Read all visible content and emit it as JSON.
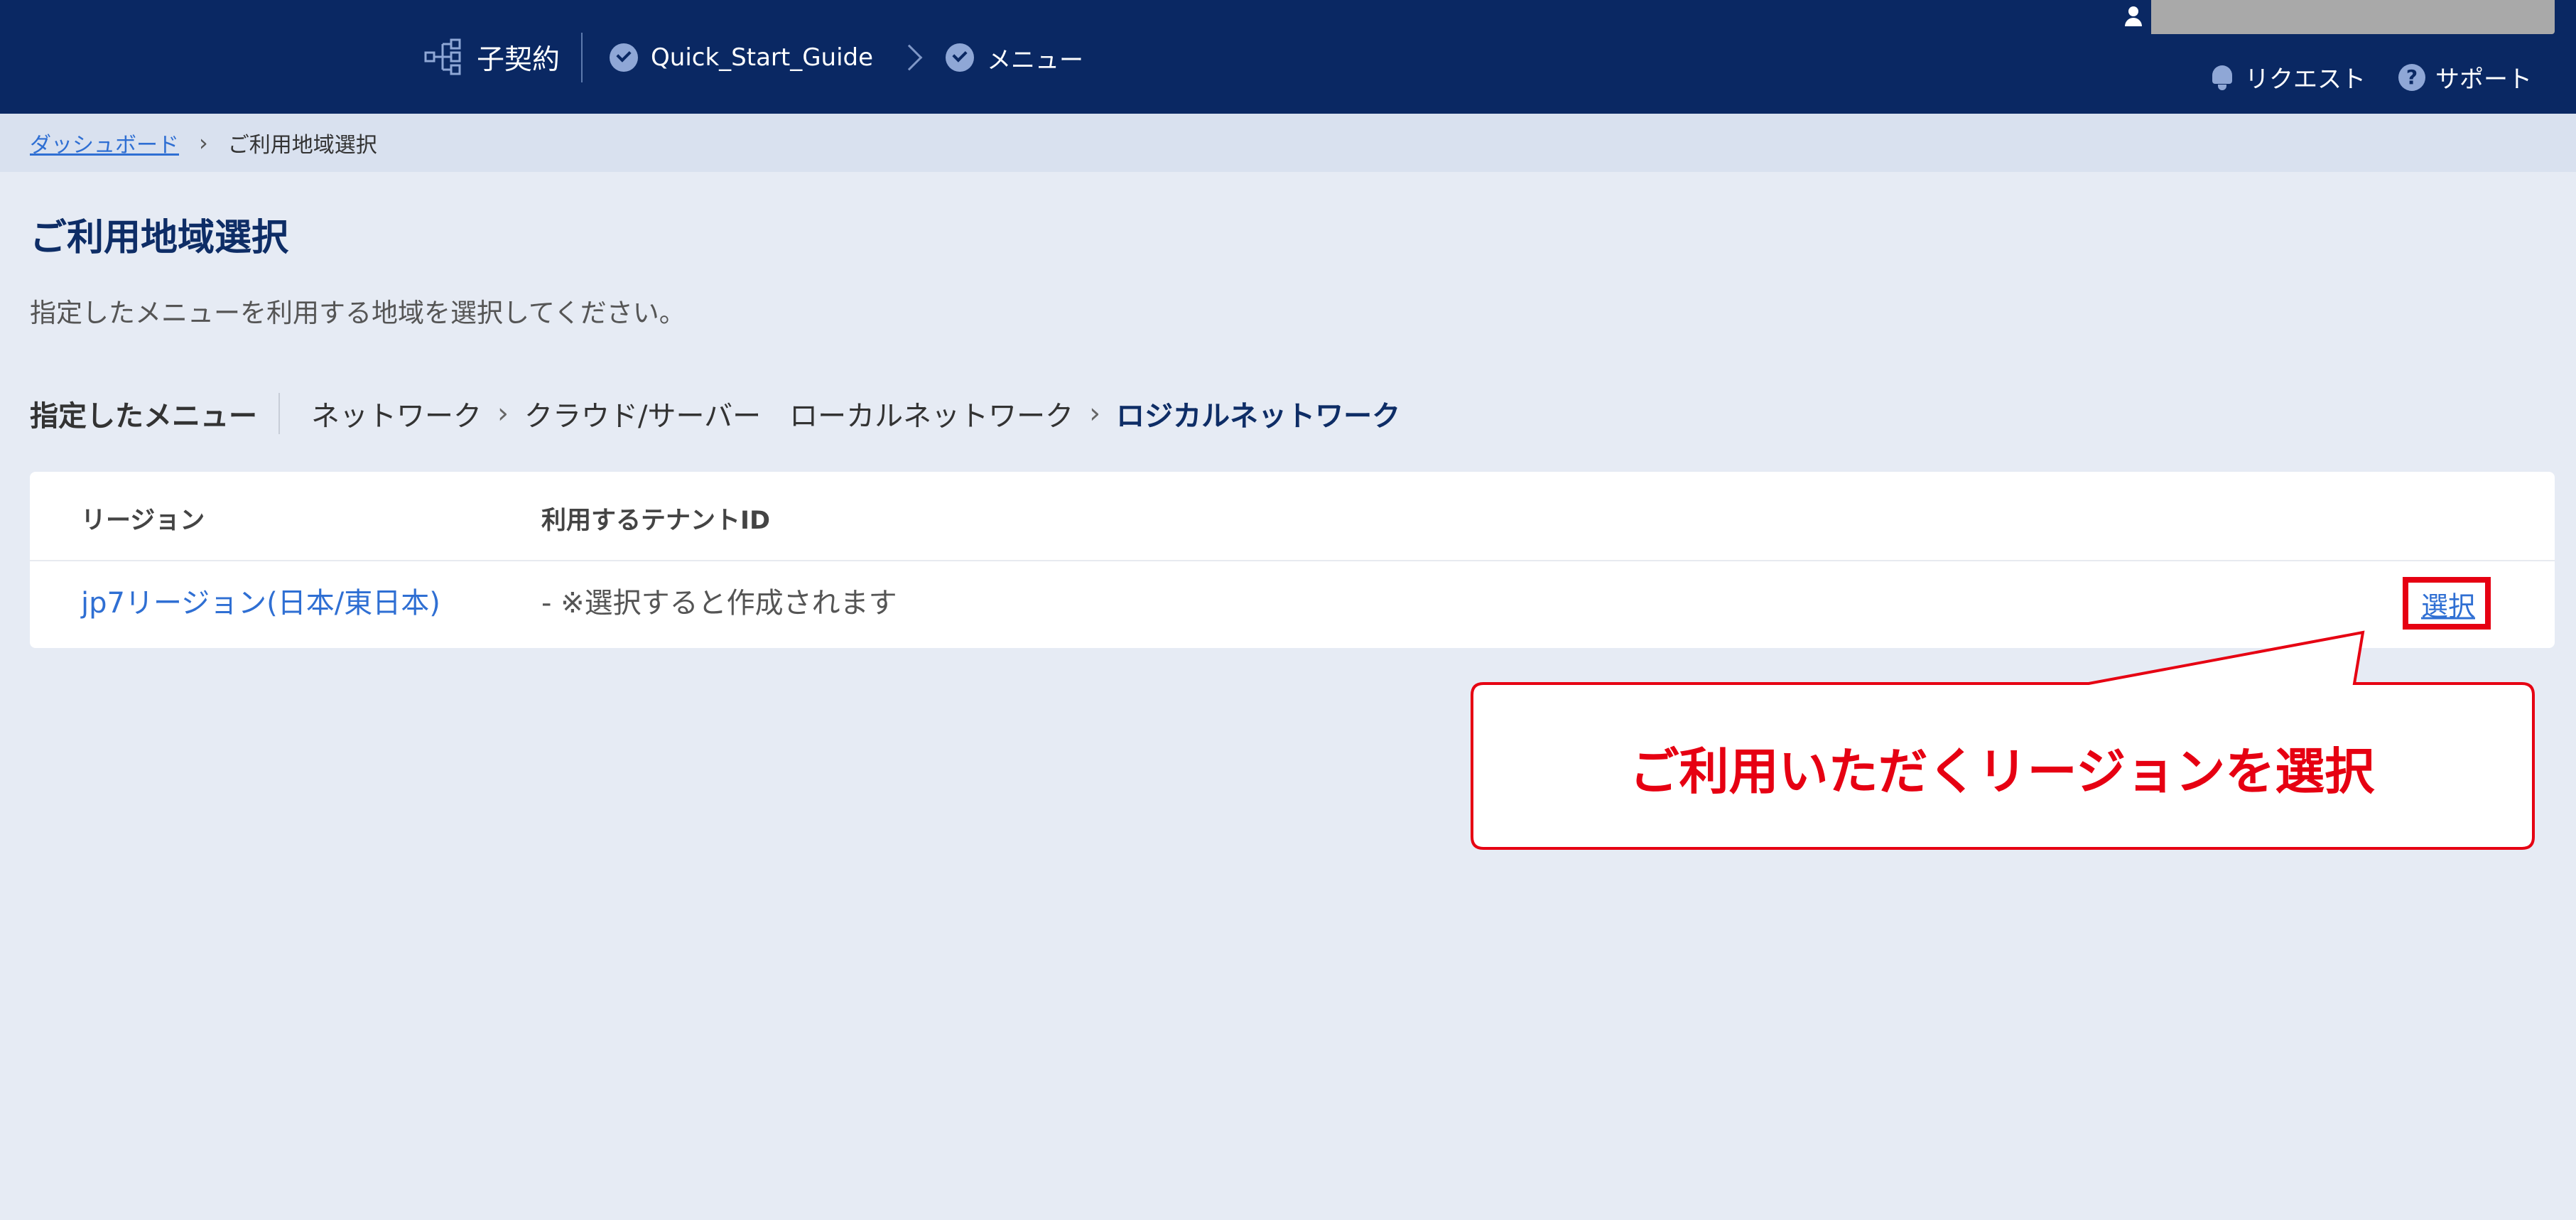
{
  "header": {
    "contract_label": "子契約",
    "crumbs": [
      "Quick_Start_Guide",
      "メニュー"
    ],
    "links": {
      "request": "リクエスト",
      "support": "サポート"
    },
    "colors": {
      "bar": "#0a2863",
      "icon": "#8fa7d6"
    }
  },
  "breadcrumb": {
    "home": "ダッシュボード",
    "current": "ご利用地域選択"
  },
  "page": {
    "title": "ご利用地域選択",
    "description": "指定したメニューを利用する地域を選択してください。"
  },
  "menu_path": {
    "label": "指定したメニュー",
    "items": [
      "ネットワーク",
      "クラウド/サーバー",
      "ローカルネットワーク",
      "ロジカルネットワーク"
    ]
  },
  "table": {
    "headers": {
      "region": "リージョン",
      "tenant": "利用するテナントID"
    },
    "rows": [
      {
        "region": "jp7リージョン(日本/東日本)",
        "tenant": "- ※選択すると作成されます",
        "action": "選択"
      }
    ]
  },
  "callout": {
    "text": "ご利用いただくリージョンを選択",
    "color": "#e60012"
  }
}
